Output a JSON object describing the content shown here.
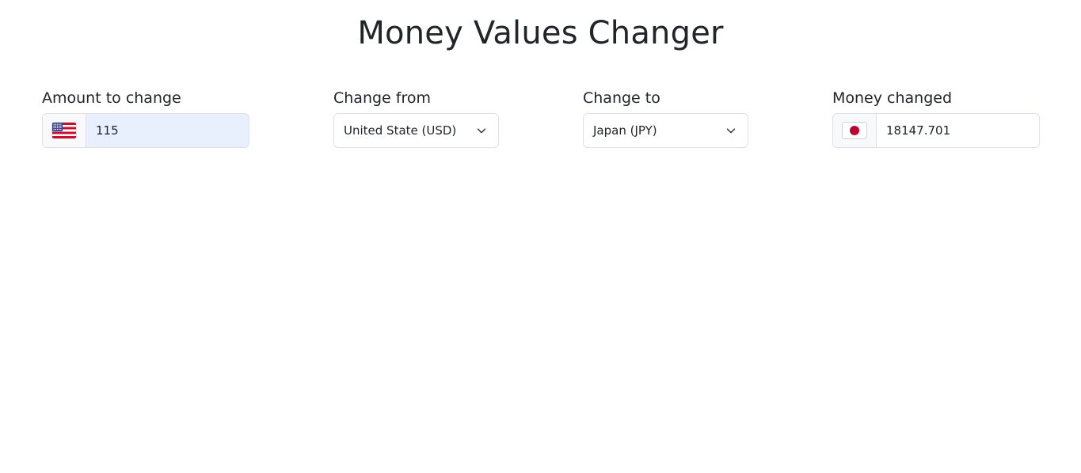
{
  "page": {
    "title": "Money Values Changer"
  },
  "amount": {
    "label": "Amount to change",
    "value": "115",
    "flag": "us-flag-icon"
  },
  "from": {
    "label": "Change from",
    "selected": "United State (USD)"
  },
  "to": {
    "label": "Change to",
    "selected": "Japan (JPY)"
  },
  "result": {
    "label": "Money changed",
    "value": "18147.701",
    "flag": "jp-flag-icon"
  },
  "colors": {
    "border": "#dee2e6",
    "addon_bg": "#f8f9fa",
    "autofill_bg": "#e8f0fe",
    "text": "#212529"
  }
}
